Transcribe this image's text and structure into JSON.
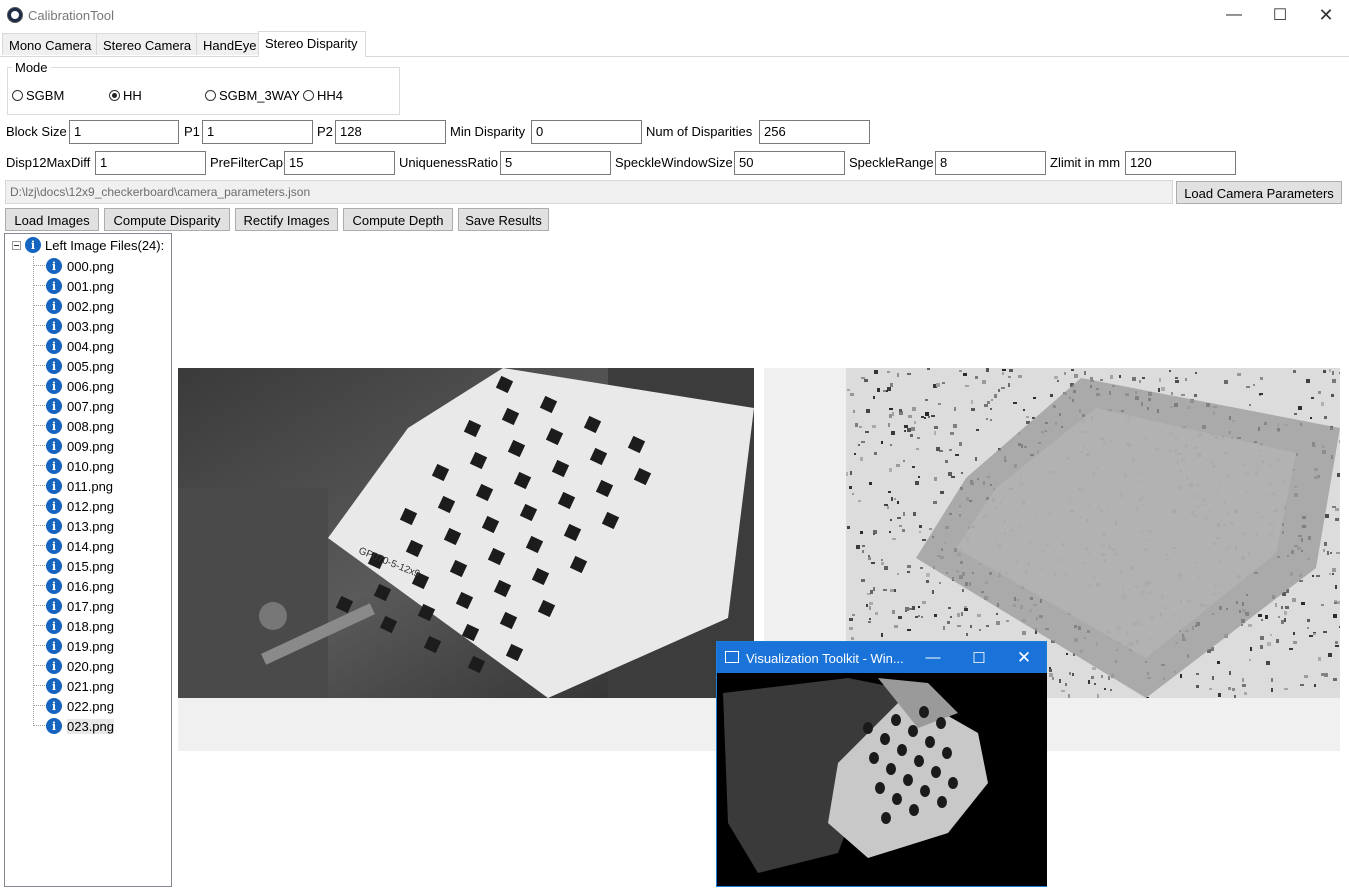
{
  "window": {
    "title": "CalibrationTool"
  },
  "tabs": [
    {
      "label": "Mono Camera",
      "active": false
    },
    {
      "label": "Stereo Camera",
      "active": false
    },
    {
      "label": "HandEye",
      "active": false
    },
    {
      "label": "Stereo Disparity",
      "active": true
    }
  ],
  "mode": {
    "title": "Mode",
    "options": [
      {
        "label": "SGBM",
        "checked": false
      },
      {
        "label": "HH",
        "checked": true
      },
      {
        "label": "SGBM_3WAY",
        "checked": false
      },
      {
        "label": "HH4",
        "checked": false
      }
    ]
  },
  "params": {
    "block_size": {
      "label": "Block Size",
      "value": "1"
    },
    "p1": {
      "label": "P1",
      "value": "1"
    },
    "p2": {
      "label": "P2",
      "value": "128"
    },
    "min_disparity": {
      "label": "Min Disparity",
      "value": "0"
    },
    "num_disparities": {
      "label": "Num of Disparities",
      "value": "256"
    },
    "disp12maxdiff": {
      "label": "Disp12MaxDiff",
      "value": "1"
    },
    "prefiltercap": {
      "label": "PreFilterCap",
      "value": "15"
    },
    "uniqueness_ratio": {
      "label": "UniquenessRatio",
      "value": "5"
    },
    "speckle_window_size": {
      "label": "SpeckleWindowSize",
      "value": "50"
    },
    "speckle_range": {
      "label": "SpeckleRange",
      "value": "8"
    },
    "zlimit": {
      "label": "Zlimit in mm",
      "value": "120"
    }
  },
  "camera_params": {
    "path": "D:\\lzj\\docs\\12x9_checkerboard\\camera_parameters.json",
    "load_label": "Load Camera Parameters"
  },
  "toolbar": {
    "load_images": "Load Images",
    "compute_disparity": "Compute Disparity",
    "rectify_images": "Rectify Images",
    "compute_depth": "Compute Depth",
    "save_results": "Save Results"
  },
  "file_tree": {
    "root_label": "Left Image Files(24):",
    "root_icon": "info-icon",
    "files": [
      "000.png",
      "001.png",
      "002.png",
      "003.png",
      "004.png",
      "005.png",
      "006.png",
      "007.png",
      "008.png",
      "009.png",
      "010.png",
      "011.png",
      "012.png",
      "013.png",
      "014.png",
      "015.png",
      "016.png",
      "017.png",
      "018.png",
      "019.png",
      "020.png",
      "021.png",
      "022.png",
      "023.png"
    ],
    "selected": "023.png"
  },
  "vtk_window": {
    "title": "Visualization Toolkit - Win...",
    "accent": "#1a73d9"
  },
  "colors": {
    "accent": "#1565c0",
    "window_bg": "#ffffff",
    "control_bg": "#e1e1e1"
  }
}
